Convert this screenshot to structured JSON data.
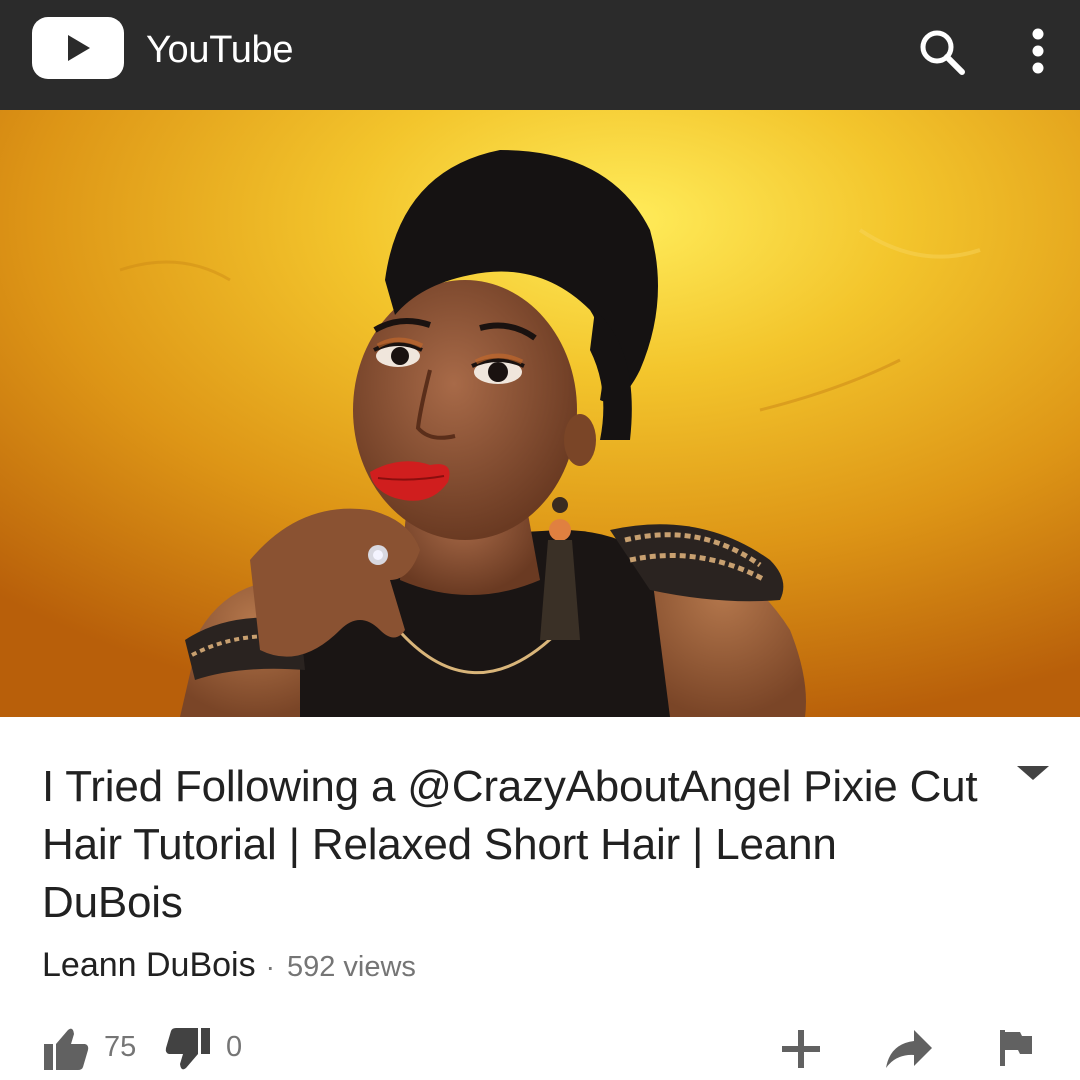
{
  "colors": {
    "topbar": "#2b2b2b",
    "text_primary": "#212121",
    "text_secondary": "#757575",
    "icon_gray": "#616161",
    "thumbnail_gold": "#e0a218"
  },
  "topbar": {
    "app_name": "YouTube",
    "logo_icon": "youtube-play-logo",
    "search_icon": "search-icon",
    "more_icon": "more-vert-icon"
  },
  "video": {
    "thumbnail_description_icon": "video-thumbnail",
    "title": "I Tried Following a @CrazyAboutAngel Pixie Cut Hair Tutorial | Relaxed Short Hair | Leann DuBois",
    "expand_icon": "expand-arrow-icon",
    "channel": "Leann DuBois",
    "separator": "·",
    "views": "592 views"
  },
  "actions": {
    "like_count": "75",
    "dislike_count": "0",
    "icons": [
      "thumb-up-icon",
      "thumb-down-icon",
      "add-to-playlist-icon",
      "share-icon",
      "flag-icon"
    ]
  }
}
